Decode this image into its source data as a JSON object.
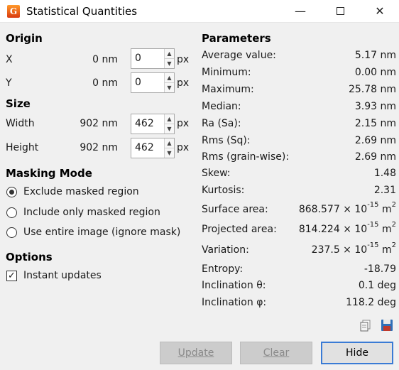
{
  "window": {
    "title": "Statistical Quantities"
  },
  "origin": {
    "heading": "Origin",
    "x_label": "X",
    "x_value": "0 nm",
    "x_input": "0",
    "x_unit": "px",
    "y_label": "Y",
    "y_value": "0 nm",
    "y_input": "0",
    "y_unit": "px"
  },
  "size": {
    "heading": "Size",
    "width_label": "Width",
    "width_value": "902 nm",
    "width_input": "462",
    "width_unit": "px",
    "height_label": "Height",
    "height_value": "902 nm",
    "height_input": "462",
    "height_unit": "px"
  },
  "masking": {
    "heading": "Masking Mode",
    "options": [
      "Exclude masked region",
      "Include only masked region",
      "Use entire image (ignore mask)"
    ],
    "selected": "Exclude masked region"
  },
  "options": {
    "heading": "Options",
    "instant_updates_label": "Instant updates",
    "instant_updates_checked": true
  },
  "parameters": {
    "heading": "Parameters",
    "rows": [
      {
        "label": "Average value:",
        "value": "5.17 nm"
      },
      {
        "label": "Minimum:",
        "value": "0.00 nm"
      },
      {
        "label": "Maximum:",
        "value": "25.78 nm"
      },
      {
        "label": "Median:",
        "value": "3.93 nm"
      },
      {
        "label": "Ra (Sa):",
        "value": "2.15 nm"
      },
      {
        "label": "Rms (Sq):",
        "value": "2.69 nm"
      },
      {
        "label": "Rms (grain-wise):",
        "value": "2.69 nm"
      },
      {
        "label": "Skew:",
        "value": "1.48"
      },
      {
        "label": "Kurtosis:",
        "value": "2.31"
      },
      {
        "label": "Surface area:",
        "mantissa": "868.577 × 10",
        "exp": "-15",
        "unit": " m",
        "unit_exp": "2"
      },
      {
        "label": "Projected area:",
        "mantissa": "814.224 × 10",
        "exp": "-15",
        "unit": " m",
        "unit_exp": "2"
      },
      {
        "label": "Variation:",
        "mantissa": "237.5 × 10",
        "exp": "-15",
        "unit": " m",
        "unit_exp": "2"
      },
      {
        "label": "Entropy:",
        "value": "-18.79"
      },
      {
        "label": "Inclination θ:",
        "value": "0.1 deg"
      },
      {
        "label": "Inclination φ:",
        "value": "118.2 deg"
      }
    ]
  },
  "buttons": {
    "update": "Update",
    "clear": "Clear",
    "hide": "Hide"
  },
  "icons": {
    "copy": "copy-icon",
    "save": "save-icon"
  }
}
